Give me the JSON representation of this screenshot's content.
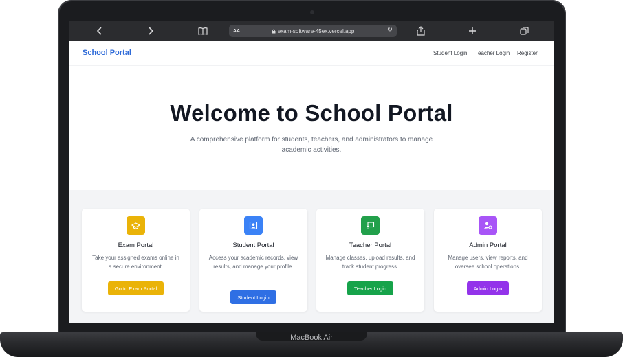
{
  "device": {
    "model_label": "MacBook Air"
  },
  "browser": {
    "text_size_label": "AA",
    "url": "exam-software-45ex.vercel.app",
    "icons": [
      "chevron-left-icon",
      "chevron-right-icon",
      "book-icon",
      "lock-icon",
      "reload-icon",
      "share-icon",
      "plus-icon",
      "tabs-icon"
    ]
  },
  "navbar": {
    "brand": "School Portal",
    "links": [
      "Student Login",
      "Teacher Login",
      "Register"
    ]
  },
  "hero": {
    "title": "Welcome to School Portal",
    "subtitle": "A comprehensive platform for students, teachers, and administrators to manage academic activities."
  },
  "cards": [
    {
      "title": "Exam Portal",
      "description": "Take your assigned exams online in a secure environment.",
      "button": "Go to Exam Portal",
      "color": "#eab308",
      "icon": "exam-icon"
    },
    {
      "title": "Student Portal",
      "description": "Access your academic records, view results, and manage your profile.",
      "button": "Student Login",
      "color": "#3b82f6",
      "icon": "student-icon"
    },
    {
      "title": "Teacher Portal",
      "description": "Manage classes, upload results, and track student progress.",
      "button": "Teacher Login",
      "color": "#16a34a",
      "icon": "teacher-icon"
    },
    {
      "title": "Admin Portal",
      "description": "Manage users, view reports, and oversee school operations.",
      "button": "Admin Login",
      "color": "#9333ea",
      "icon": "admin-icon"
    }
  ],
  "colors": {
    "brand": "#2f6bd8",
    "section_bg": "#f3f4f6",
    "browser_bar": "#2b2c2f"
  }
}
